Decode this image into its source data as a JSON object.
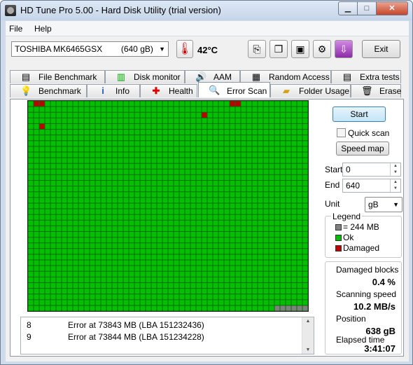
{
  "window": {
    "title": "HD Tune Pro 5.00 - Hard Disk Utility (trial version)"
  },
  "menu": {
    "file": "File",
    "help": "Help"
  },
  "toolbar": {
    "drive": "TOSHIBA MK6465GSX        (640 gB)",
    "temperature": "42°C",
    "exit_label": "Exit",
    "buttons": [
      "copy-info-icon",
      "copy-screenshot-icon",
      "save-icon",
      "options-icon",
      "download-icon"
    ]
  },
  "tabs_row1": [
    {
      "label": "File Benchmark",
      "icon": "file-benchmark-icon"
    },
    {
      "label": "Disk monitor",
      "icon": "disk-monitor-icon"
    },
    {
      "label": "AAM",
      "icon": "speaker-icon"
    },
    {
      "label": "Random Access",
      "icon": "random-access-icon"
    },
    {
      "label": "Extra tests",
      "icon": "extra-tests-icon"
    }
  ],
  "tabs_row2": [
    {
      "label": "Benchmark",
      "icon": "lightbulb-icon"
    },
    {
      "label": "Info",
      "icon": "info-icon"
    },
    {
      "label": "Health",
      "icon": "health-cross-icon"
    },
    {
      "label": "Error Scan",
      "icon": "magnifier-icon",
      "active": true
    },
    {
      "label": "Folder Usage",
      "icon": "folder-icon"
    },
    {
      "label": "Erase",
      "icon": "trash-icon"
    }
  ],
  "controls": {
    "start_label": "Start",
    "quick_scan_label": "Quick scan",
    "quick_scan_checked": false,
    "speed_map_label": "Speed map",
    "start_field_label": "Start",
    "start_value": "0",
    "end_field_label": "End",
    "end_value": "640",
    "unit_label": "Unit",
    "unit_value": "gB"
  },
  "legend": {
    "title": "Legend",
    "block_size": "= 244 MB",
    "ok": "Ok",
    "damaged": "Damaged",
    "colors": {
      "block": "#808080",
      "ok": "#00c000",
      "damaged": "#c00000",
      "unscanned": "#808080"
    }
  },
  "stats": {
    "damaged_blocks_label": "Damaged blocks",
    "damaged_blocks_value": "0.4 %",
    "scanning_speed_label": "Scanning speed",
    "scanning_speed_value": "10.2 MB/s",
    "position_label": "Position",
    "position_value": "638 gB",
    "elapsed_label": "Elapsed time",
    "elapsed_value": "3:41:07"
  },
  "scan_grid": {
    "columns": 50,
    "rows": 37,
    "damaged_cells": [
      [
        0,
        1
      ],
      [
        0,
        2
      ],
      [
        4,
        2
      ],
      [
        2,
        31
      ],
      [
        0,
        36
      ],
      [
        0,
        37
      ]
    ],
    "unscanned_from_last_row_col": 44
  },
  "errors": [
    {
      "index": "8",
      "text": "Error at 73843 MB (LBA 151232436)"
    },
    {
      "index": "9",
      "text": "Error at 73844 MB (LBA 151234228)"
    }
  ]
}
